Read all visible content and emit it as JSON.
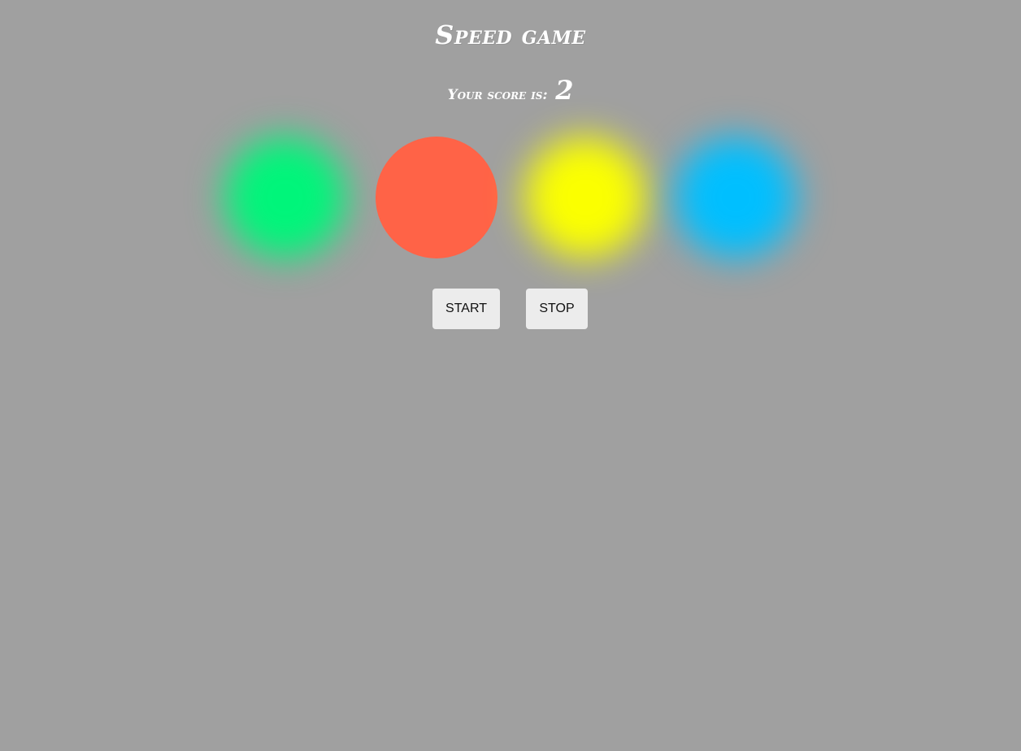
{
  "title": "Speed game",
  "score": {
    "label": "Your score is:",
    "value": "2"
  },
  "circles": [
    {
      "name": "green",
      "color": "#00f57a",
      "glowing": true
    },
    {
      "name": "red",
      "color": "#ff6347",
      "glowing": false
    },
    {
      "name": "yellow",
      "color": "#fbff00",
      "glowing": true
    },
    {
      "name": "blue",
      "color": "#00bfff",
      "glowing": true
    }
  ],
  "buttons": {
    "start_label": "START",
    "stop_label": "STOP"
  },
  "colors": {
    "background": "#a0a0a0",
    "text": "#ffffff",
    "button_bg": "#ececec"
  }
}
